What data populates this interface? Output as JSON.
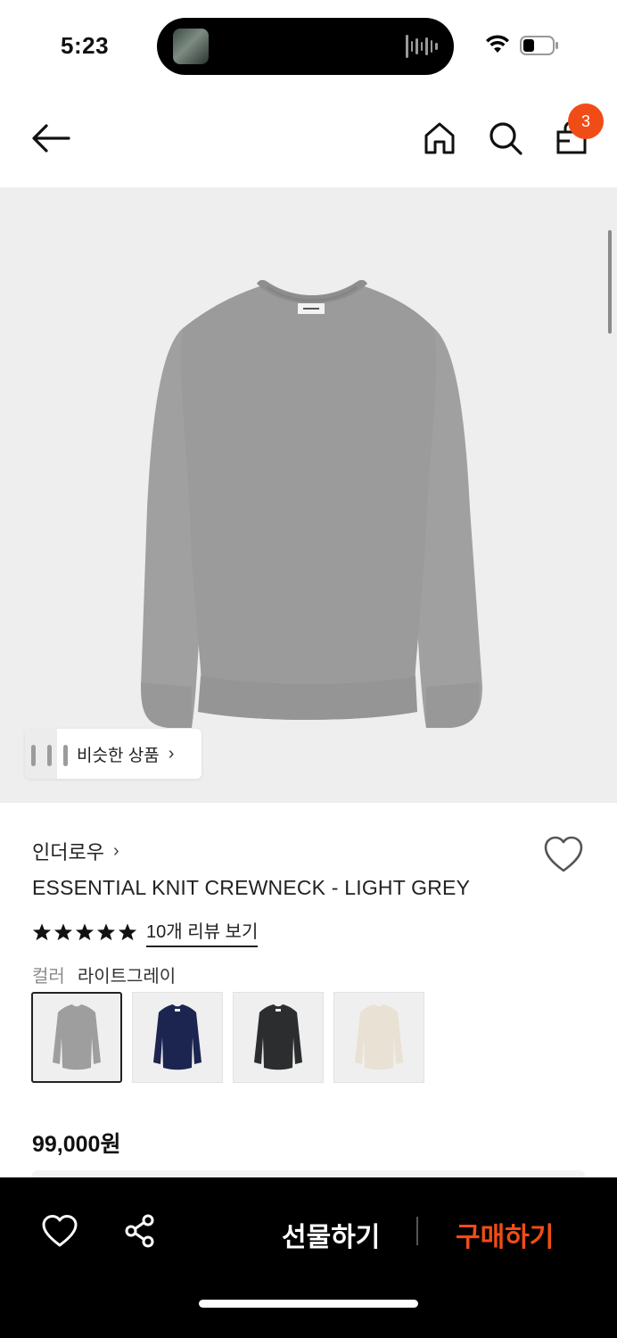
{
  "status_bar": {
    "time": "5:23"
  },
  "cart": {
    "badge_count": "3"
  },
  "similar": {
    "label": "비슷한 상품"
  },
  "product": {
    "brand": "인더로우",
    "title": "ESSENTIAL KNIT CREWNECK - LIGHT GREY",
    "rating_stars": 5,
    "review_link": "10개 리뷰 보기",
    "color_label": "컬러",
    "color_value": "라이트그레이",
    "swatches": [
      "light-grey",
      "navy",
      "charcoal",
      "ivory"
    ],
    "price": "99,000원"
  },
  "bottom_bar": {
    "gift_label": "선물하기",
    "buy_label": "구매하기"
  },
  "colors": {
    "accent": "#f04c17",
    "sweater_grey": "#9b9b9b",
    "navy": "#1c2550",
    "charcoal": "#2b2d2e",
    "ivory": "#e9e1d4"
  }
}
